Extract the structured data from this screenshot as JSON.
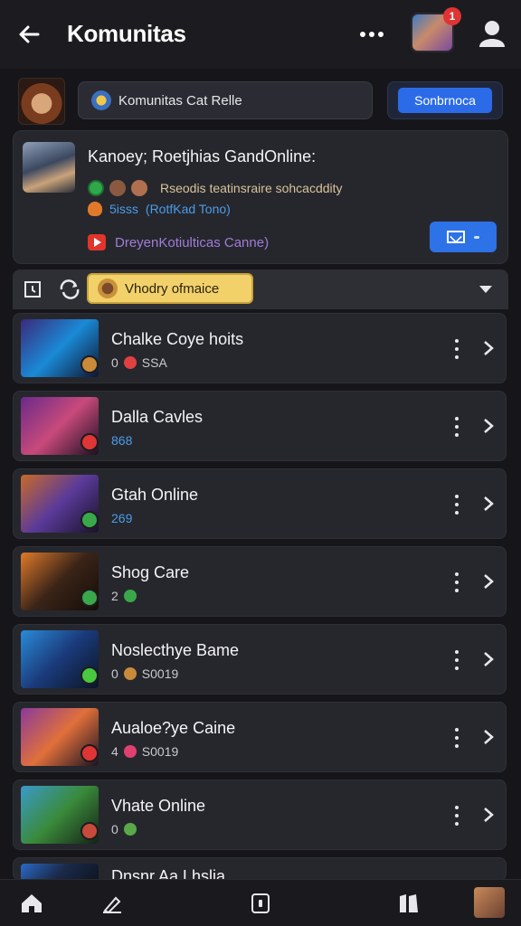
{
  "header": {
    "title": "Komunitas",
    "notification_count": "1"
  },
  "search": {
    "text": "Komunitas Cat Relle"
  },
  "follow_button": {
    "label": "Sonbrnoca"
  },
  "info_card": {
    "title": "Kanoey; Roetjhias GandOnline:",
    "row1_text": "Rseodis teatinsraire sohcacddity",
    "row2_a": "5isss",
    "row2_b": "(RotfKad Tono)",
    "row3_text": "DreyenKotiulticas Canne)"
  },
  "filter": {
    "chip_label": "Vhodry ofmaice"
  },
  "items": [
    {
      "name": "Chalke Coye hoits",
      "sub_a": "0",
      "sub_b": "SSA",
      "sub_style": "plain",
      "badge": "#c98a3a",
      "thumb": [
        "#3a2a7a",
        "#1a8ad6",
        "#0e1530"
      ],
      "sub_icon": "#e04040"
    },
    {
      "name": "Dalla Cavles",
      "sub_a": "868",
      "sub_b": "",
      "sub_style": "blue",
      "badge": "#e03535",
      "thumb": [
        "#6a2a8a",
        "#c84a7a",
        "#1a1020"
      ],
      "sub_icon": ""
    },
    {
      "name": "Gtah Online",
      "sub_a": "269",
      "sub_b": "",
      "sub_style": "blue",
      "badge": "#3aa84a",
      "thumb": [
        "#c86a2a",
        "#5a3a9a",
        "#1a1228"
      ],
      "sub_icon": ""
    },
    {
      "name": "Shog Care",
      "sub_a": "2",
      "sub_b": "",
      "sub_style": "plain",
      "badge": "#3aa84a",
      "thumb": [
        "#e07a2a",
        "#3a2418",
        "#140c08"
      ],
      "sub_icon": "#3aa84a"
    },
    {
      "name": "Noslecthye Bame",
      "sub_a": "0",
      "sub_b": "S0019",
      "sub_style": "plain",
      "badge": "#4ac840",
      "thumb": [
        "#2a8ad6",
        "#1a3a7a",
        "#0c1424"
      ],
      "sub_icon": "#c98a3a"
    },
    {
      "name": "Aualoe?ye Caine",
      "sub_a": "4",
      "sub_b": "S0019",
      "sub_style": "plain",
      "badge": "#e03535",
      "thumb": [
        "#8a3a9a",
        "#e0703a",
        "#1a1222"
      ],
      "sub_icon": "#e04070"
    },
    {
      "name": "Vhate Online",
      "sub_a": "0",
      "sub_b": "",
      "sub_style": "plain",
      "badge": "#c84a3a",
      "thumb": [
        "#3a9ac8",
        "#3a8a3a",
        "#142018"
      ],
      "sub_icon": "#5aa84a"
    },
    {
      "name": "Dnsnr Aa Lhslia",
      "sub_a": "",
      "sub_b": "",
      "sub_style": "plain",
      "badge": "",
      "thumb": [
        "#2a6ac8",
        "#1a2a4a",
        "#0e1420"
      ],
      "sub_icon": ""
    }
  ]
}
